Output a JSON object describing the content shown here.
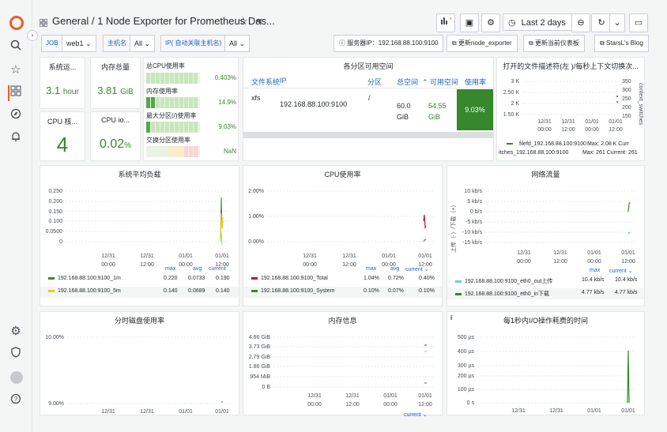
{
  "topbar": {
    "breadcrumb": "General  /  1 Node Exporter for Prometheus Das...",
    "time_range": "Last 2 days"
  },
  "variables": {
    "job_label": "JOB",
    "job_value": "web1",
    "host_label": "主机名",
    "host_value": "All",
    "ip_label": "IP( 自动关联主机名)",
    "ip_value": "All",
    "server_ip": "服务器IP：192.168.88.100:9100",
    "link_update_exporter": "更新node_exporter",
    "link_update_dashboard": "更新当前仪表板",
    "link_blog": "StarsL's Blog"
  },
  "stats": {
    "uptime_title": "系统运...",
    "uptime_value": "3.1",
    "uptime_unit": "hour",
    "mem_title": "内存总量",
    "mem_value": "3.81",
    "mem_unit": "GiB",
    "cpu_cores_title": "CPU 核...",
    "cpu_cores_value": "4",
    "cpu_io_title": "CPU io...",
    "cpu_io_value": "0.02",
    "cpu_io_unit": "%"
  },
  "gauges": [
    {
      "label": "总CPU使用率",
      "value": "0.403%",
      "level": 0.004
    },
    {
      "label": "内存使用率",
      "value": "14.9%",
      "level": 0.149
    },
    {
      "label": "最大分区(/)使用率",
      "value": "9.03%",
      "level": 0.09
    },
    {
      "label": "交换分区使用率",
      "value": "NaN",
      "level": 0
    }
  ],
  "disk_table": {
    "title": "各分区可用空间",
    "headers": [
      "文件系统",
      "IP",
      "分区",
      "总空间",
      "可用空间",
      "使用率"
    ],
    "row": {
      "fs": "xfs",
      "ip": "192.168.88.100:9100",
      "mount": "/",
      "total": "60.0 GiB",
      "avail": "54.55 GiB",
      "used": "9.03%"
    }
  },
  "fd_panel": {
    "title": "打开的文件描述符(左 )/每秒上下文切换次...",
    "yleft": [
      "3 K",
      "2.50 K",
      "2 K",
      "1.50 K"
    ],
    "yright": [
      "350",
      "300",
      "250",
      "200",
      "150"
    ],
    "yright_label": "context_switches",
    "xticks": [
      "12/31\n00:00",
      "12/31\n12:00",
      "01/01\n00:00",
      "01/01\n12:00"
    ],
    "legend": [
      {
        "name": "filefd_192.168.88.100:9100",
        "stat": "Max: 2.08 K  Curr",
        "color": "#37872d"
      },
      {
        "name": "itches_192.168.88.100:9100",
        "stat": "Max: 261  Current: 261",
        "color": "#f2cc0c"
      }
    ]
  },
  "load_panel": {
    "title": "系统平均负载",
    "yticks": [
      "0.250",
      "0.200",
      "0.150",
      "0.100",
      "0.0500",
      "0"
    ],
    "xticks": [
      "12/31",
      "12/31",
      "01/01",
      "01/01"
    ],
    "xticks2": [
      "00:00",
      "12:00",
      "00:00",
      "12:00"
    ],
    "headers": [
      "max",
      "avg",
      "current"
    ],
    "series": [
      {
        "name": "192.168.88.100:9100_1m",
        "max": "0.220",
        "avg": "0.0733",
        "current": "0.190",
        "color": "#37872d"
      },
      {
        "name": "192.168.88.100:9100_5m",
        "max": "0.140",
        "avg": "0.0689",
        "current": "0.140",
        "color": "#f2cc0c"
      }
    ]
  },
  "cpu_panel": {
    "title": "CPU使用率",
    "yticks": [
      "2.00%",
      "1.00%",
      "0.00%"
    ],
    "xticks": [
      "12/31",
      "12/31",
      "01/01",
      "01/01"
    ],
    "xticks2": [
      "00:00",
      "12:00",
      "00:00",
      "12:00"
    ],
    "headers": [
      "max",
      "avg",
      "current ⌄"
    ],
    "series": [
      {
        "name": "192.168.88.100:9100_Total",
        "max": "1.04%",
        "avg": "0.72%",
        "current": "0.40%",
        "color": "#c4162a"
      },
      {
        "name": "192.168.88.100:9100_System",
        "max": "0.10%",
        "avg": "0.07%",
        "current": "0.10%",
        "color": "#37872d"
      }
    ]
  },
  "net_panel": {
    "title": "网络流量",
    "ylabel": "上传（-）/下载（+）",
    "yticks": [
      "10 kb/s",
      "5 kb/s",
      "0 b/s",
      "-5 kb/s",
      "-10 kb/s",
      "-15 kb/s"
    ],
    "xticks": [
      "12/31",
      "12/31",
      "01/01",
      "01/01"
    ],
    "xticks2": [
      "00:00",
      "12:00",
      "00:00",
      "12:00"
    ],
    "headers": [
      "max",
      "current ⌄"
    ],
    "series": [
      {
        "name": "192.168.88.100:9100_eth0_out上传",
        "max": "10.4 kb/s",
        "current": "10.4 kb/s",
        "color": "#5ed5e5"
      },
      {
        "name": "192.168.88.100:9100_eth0_in下载",
        "max": "4.77 kb/s",
        "current": "4.77 kb/s",
        "color": "#37872d"
      }
    ]
  },
  "disk_usage_panel": {
    "title": "分时磁盘使用率",
    "yticks": [
      "10.00%",
      "9.00%"
    ],
    "xticks": [
      "12/31",
      "12/31",
      "01/01",
      "01/01"
    ]
  },
  "mem_panel": {
    "title": "内存信息",
    "yticks": [
      "4.66 GiB",
      "3.73 GiB",
      "2.79 GiB",
      "1.86 GiB",
      "954 MiB",
      "0 B"
    ],
    "xticks": [
      "12/31",
      "12/31",
      "01/01",
      "01/01"
    ],
    "xticks2": [
      "00:00",
      "12:00",
      "00:00",
      "12:00"
    ],
    "current": "current ⌄"
  },
  "io_panel": {
    "title": "每1秒内I/O操作耗费的时间",
    "info": "i",
    "yticks": [
      "500 µs",
      "400 µs",
      "300 µs",
      "200 µs",
      "100 µs",
      "0 s"
    ],
    "xticks": [
      "12/31",
      "12/31",
      "01/01",
      "01/01"
    ]
  }
}
